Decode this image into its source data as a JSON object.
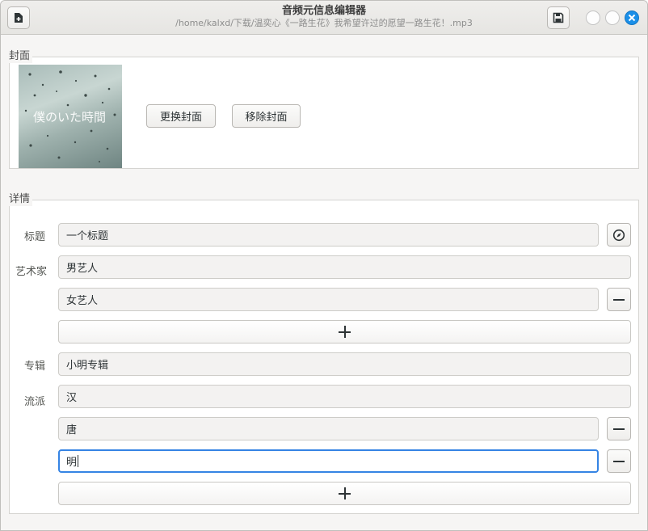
{
  "window": {
    "title": "音频元信息编辑器",
    "subtitle": "/home/kalxd/下载/温奕心《一路生花》我希望许过的愿望一路生花！.mp3"
  },
  "cover_section": {
    "label": "封面",
    "cover_text": "僕のいた時間",
    "change_button": "更换封面",
    "remove_button": "移除封面"
  },
  "details": {
    "label": "详情",
    "title_label": "标题",
    "title_value": "一个标题",
    "artist_label": "艺术家",
    "artists": [
      "男艺人",
      "女艺人"
    ],
    "album_label": "专辑",
    "album_value": "小明专辑",
    "genre_label": "流派",
    "genres": [
      "汉",
      "唐",
      "明"
    ]
  },
  "icons": {
    "new": "document-new-icon",
    "save": "save-icon",
    "minimize": "minimize-icon",
    "maximize": "maximize-icon",
    "close": "close-icon",
    "compass": "compass-icon",
    "remove": "minus-icon",
    "add": "plus-icon"
  },
  "colors": {
    "accent": "#3584e4",
    "close_button": "#1a8fe8"
  }
}
